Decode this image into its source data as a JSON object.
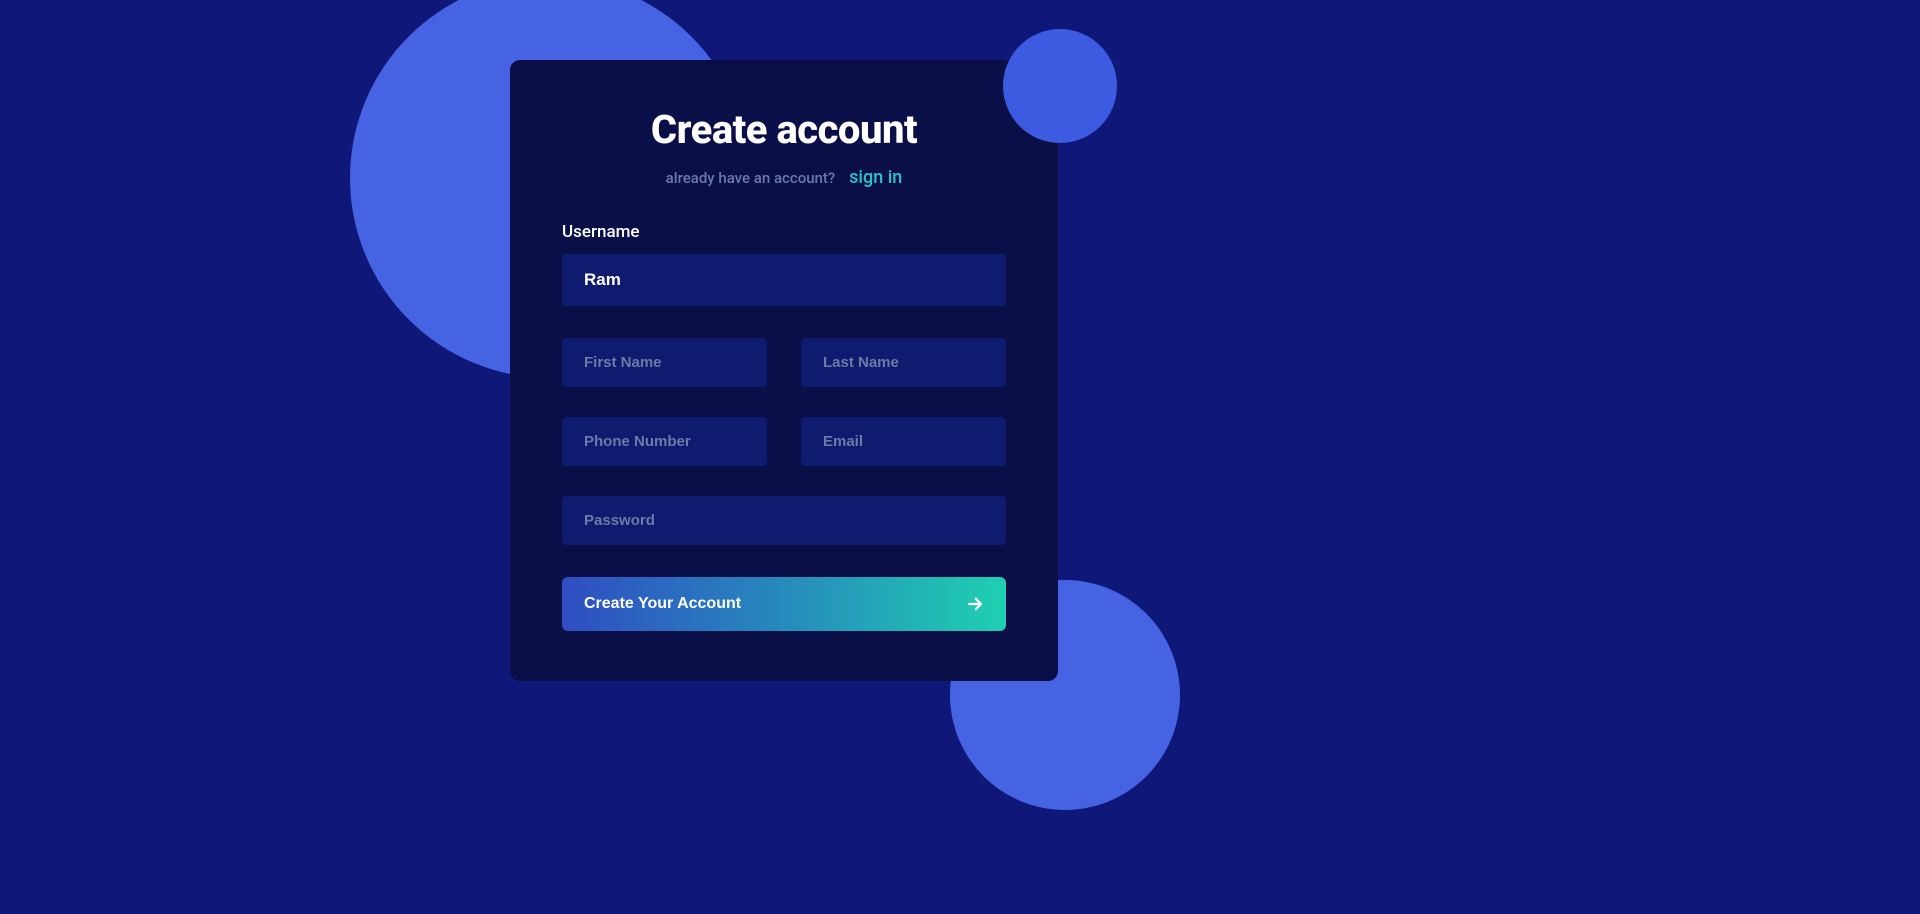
{
  "header": {
    "title": "Create account",
    "subtext": "already have an account?",
    "signin": "sign in"
  },
  "form": {
    "usernameLabel": "Username",
    "usernameValue": "Ram",
    "firstNamePlaceholder": "First Name",
    "lastNamePlaceholder": "Last Name",
    "phonePlaceholder": "Phone Number",
    "emailPlaceholder": "Email",
    "passwordPlaceholder": "Password",
    "submitLabel": "Create Your Account"
  }
}
